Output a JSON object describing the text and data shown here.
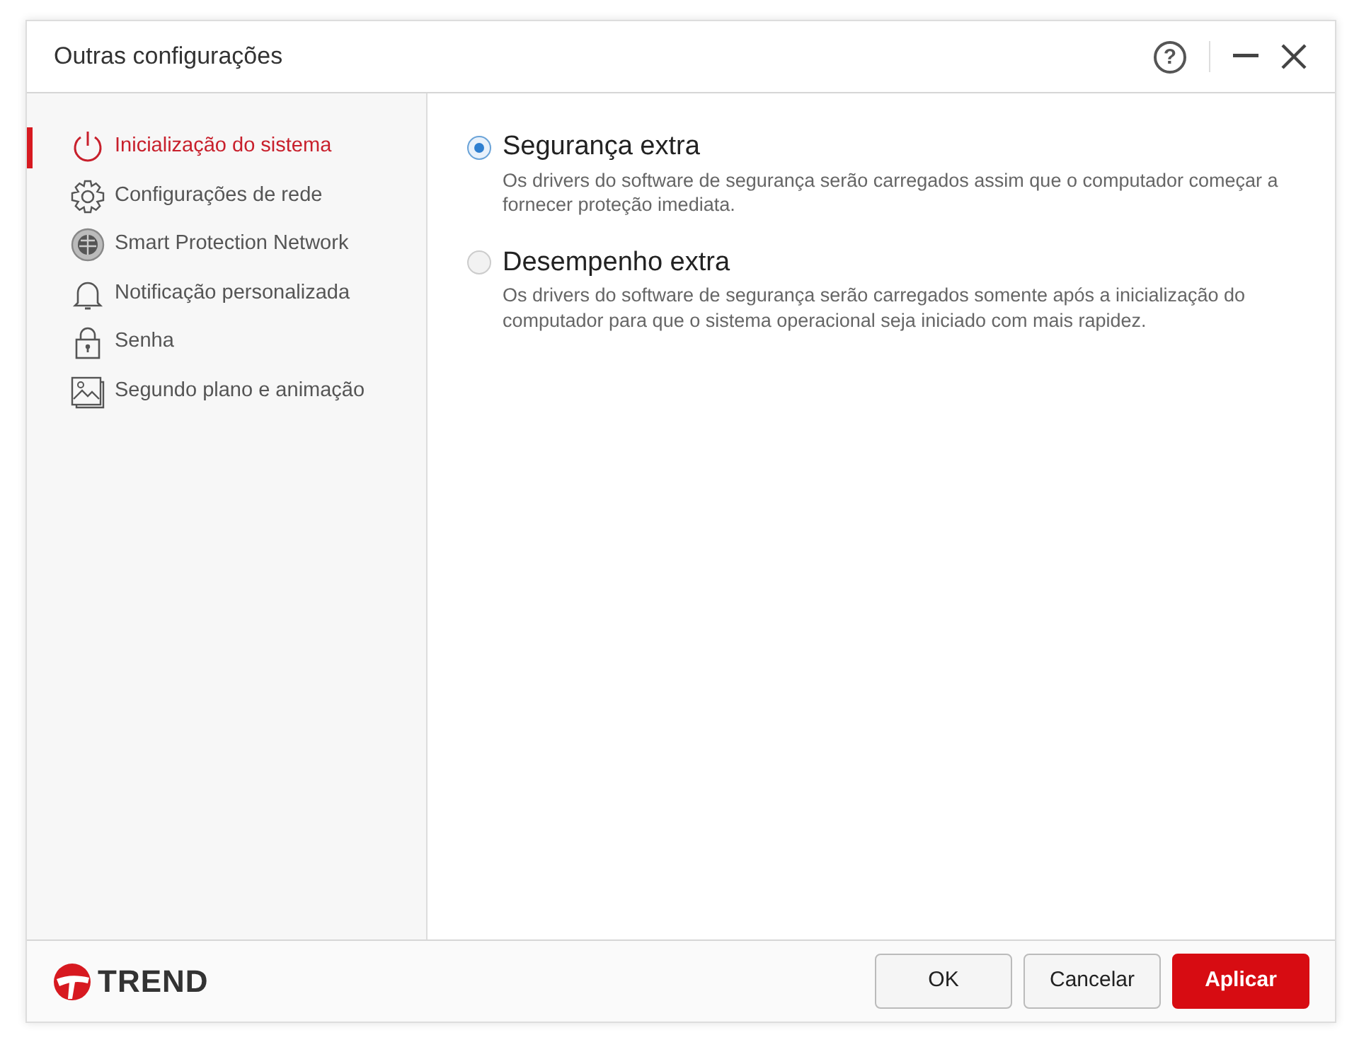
{
  "window": {
    "title": "Outras configurações",
    "help": "?"
  },
  "sidebar": {
    "items": [
      {
        "label": "Inicialização do sistema",
        "selected": true
      },
      {
        "label": "Configurações de rede",
        "selected": false
      },
      {
        "label": "Smart Protection Network",
        "selected": false
      },
      {
        "label": "Notificação personalizada",
        "selected": false
      },
      {
        "label": "Senha",
        "selected": false
      },
      {
        "label": "Segundo plano e animação",
        "selected": false
      }
    ]
  },
  "options": [
    {
      "title": "Segurança extra",
      "description": "Os drivers do software de segurança serão carregados assim que o computador começar a fornecer proteção imediata.",
      "selected": true
    },
    {
      "title": "Desempenho extra",
      "description": "Os drivers do software de segurança serão carregados somente após a inicialização do computador para que o sistema operacional seja iniciado com mais rapidez.",
      "selected": false
    }
  ],
  "footer": {
    "logo": "TREND",
    "buttons": [
      {
        "label": "OK",
        "kind": "default"
      },
      {
        "label": "Cancelar",
        "kind": "default"
      },
      {
        "label": "Aplicar",
        "kind": "primary"
      }
    ]
  }
}
